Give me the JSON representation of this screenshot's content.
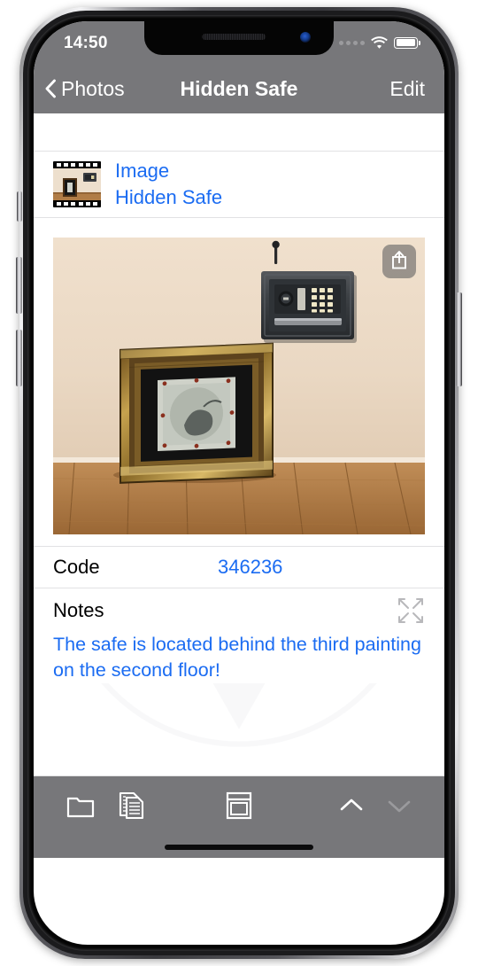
{
  "device": {
    "name": "iphone-x-frame"
  },
  "status_bar": {
    "time": "14:50",
    "cellular_icon": "signal-dots-icon",
    "wifi_icon": "wifi-icon",
    "battery_icon": "battery-full-icon"
  },
  "nav_bar": {
    "back_icon": "chevron-left-icon",
    "back_label": "Photos",
    "title": "Hidden Safe",
    "edit_label": "Edit"
  },
  "file_row": {
    "thumbnail_icon": "film-strip-thumbnail-icon",
    "type_label": "Image",
    "name_label": "Hidden Safe"
  },
  "photo": {
    "alt": "wall-safe-and-framed-engraving-photo",
    "share_icon": "share-upload-icon"
  },
  "code_row": {
    "label": "Code",
    "value": "346236"
  },
  "notes": {
    "label": "Notes",
    "expand_icon": "expand-arrows-icon",
    "text": "The safe is located behind the third painting on the second floor!"
  },
  "toolbar": {
    "folder_icon": "folder-icon",
    "copy_icon": "copy-documents-icon",
    "form_icon": "form-template-icon",
    "previous_icon": "chevron-up-icon",
    "next_icon": "chevron-down-icon",
    "home_indicator": "home-indicator"
  },
  "colors": {
    "accent_blue": "#1b6cf2",
    "chrome_gray": "#77777a",
    "separator": "#e2e2e4"
  }
}
